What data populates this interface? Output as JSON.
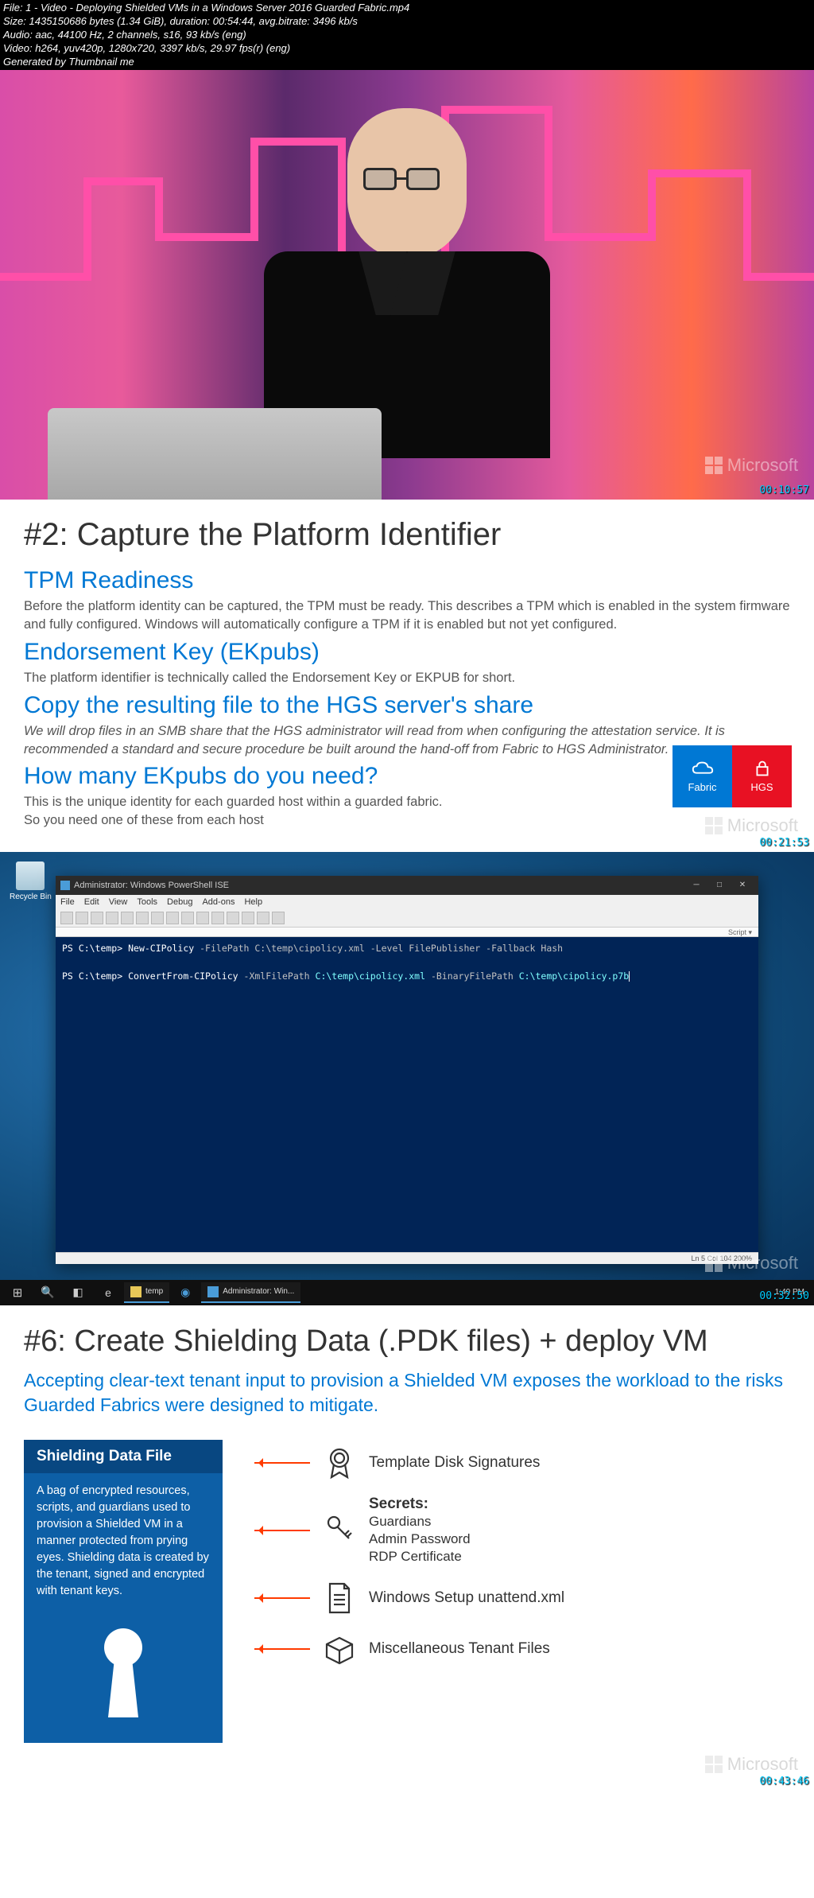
{
  "meta": {
    "file": "File: 1 - Video - Deploying Shielded VMs in a Windows Server 2016 Guarded Fabric.mp4",
    "size": "Size: 1435150686 bytes (1.34 GiB), duration: 00:54:44, avg.bitrate: 3496 kb/s",
    "audio": "Audio: aac, 44100 Hz, 2 channels, s16, 93 kb/s (eng)",
    "video": "Video: h264, yuv420p, 1280x720, 3397 kb/s, 29.97 fps(r) (eng)",
    "gen": "Generated by Thumbnail me"
  },
  "logo": "Microsoft",
  "ts": {
    "f1": "00:10:57",
    "f2": "00:21:53",
    "f3": "00:32:50",
    "f4": "00:43:46"
  },
  "slide2": {
    "title": "#2: Capture the Platform Identifier",
    "h_tpm": "TPM Readiness",
    "p_tpm": "Before the platform identity can be captured, the TPM must be ready.  This describes a TPM which is enabled in the system firmware and fully configured.  Windows will automatically configure a TPM if it is enabled but not yet configured.",
    "h_ek": "Endorsement Key (EKpubs)",
    "p_ek": "The platform identifier is technically called the Endorsement Key or EKPUB for short.",
    "h_copy": "Copy the resulting file to the HGS server's share",
    "p_copy": "We will drop files in an SMB share that the HGS administrator will read from when configuring the attestation service.  It is recommended a standard and secure procedure be built around the hand-off from Fabric to HGS Administrator.",
    "h_how": "How many EKpubs do you need?",
    "p_how1": "This is the unique identity for each guarded host within a guarded fabric.",
    "p_how2": "So you need one of these from each host",
    "tile1": "Fabric",
    "tile2": "HGS"
  },
  "desktop": {
    "recycle": "Recycle Bin",
    "ise_title": "Administrator: Windows PowerShell ISE",
    "menu": [
      "File",
      "Edit",
      "View",
      "Tools",
      "Debug",
      "Add-ons",
      "Help"
    ],
    "script_label": "Script ▾",
    "ps": {
      "line1_prompt": "PS C:\\temp>",
      "line1_cmd": "New-CIPolicy",
      "line1_rest": " -FilePath C:\\temp\\cipolicy.xml -Level FilePublisher -Fallback Hash",
      "line2_prompt": "PS C:\\temp>",
      "line2_cmd": "ConvertFrom-CIPolicy",
      "line2_p1": " -XmlFilePath ",
      "line2_path1": "C:\\temp\\cipolicy.xml",
      "line2_p2": " -BinaryFilePath ",
      "line2_path2": "C:\\temp\\cipolicy.p7b"
    },
    "status": "Ln 5  Col 104          200%",
    "task1": "temp",
    "task2": "Administrator: Win...",
    "clock": "1:40 PM"
  },
  "slide6": {
    "title": "#6: Create Shielding Data (.PDK files) + deploy VM",
    "lead": "Accepting clear-text tenant input to provision a Shielded VM exposes the workload to the risks Guarded Fabrics were designed to mitigate.",
    "box_hdr": "Shielding Data File",
    "box_body": "A bag of encrypted resources, scripts, and guardians used to provision a Shielded VM in a manner protected from prying eyes.  Shielding data is created by the tenant, signed and encrypted with tenant keys.",
    "it1": "Template Disk Signatures",
    "it2h": "Secrets:",
    "it2a": "Guardians",
    "it2b": "Admin Password",
    "it2c": "RDP Certificate",
    "it3": "Windows Setup unattend.xml",
    "it4": "Miscellaneous Tenant Files"
  }
}
